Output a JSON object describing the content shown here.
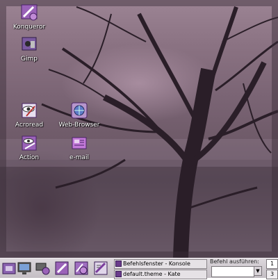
{
  "desktop": {
    "icons": [
      {
        "label": "Konqueror",
        "icon": "konqueror-icon"
      },
      {
        "label": "Gimp",
        "icon": "gimp-icon"
      },
      {
        "label": "Acroread",
        "icon": "acroread-icon"
      },
      {
        "label": "Web-Browser",
        "icon": "web-browser-icon"
      },
      {
        "label": "Action",
        "icon": "action-icon"
      },
      {
        "label": "e-mail",
        "icon": "email-icon"
      }
    ]
  },
  "panel": {
    "launchers": [
      "home-icon",
      "monitor-icon",
      "network-icon",
      "run-icon",
      "tool-icon",
      "editor-icon"
    ],
    "tasks": [
      {
        "label": "Befehlsfenster - Konsole"
      },
      {
        "label": "default.theme - Kate"
      }
    ],
    "run_command": {
      "label": "Befehl ausführen:",
      "value": ""
    },
    "pager": {
      "desktops": [
        "1",
        "3"
      ],
      "active": "1"
    }
  },
  "colors": {
    "panel": "#d2cdd2",
    "icon_purple": "#7a3c9c"
  }
}
